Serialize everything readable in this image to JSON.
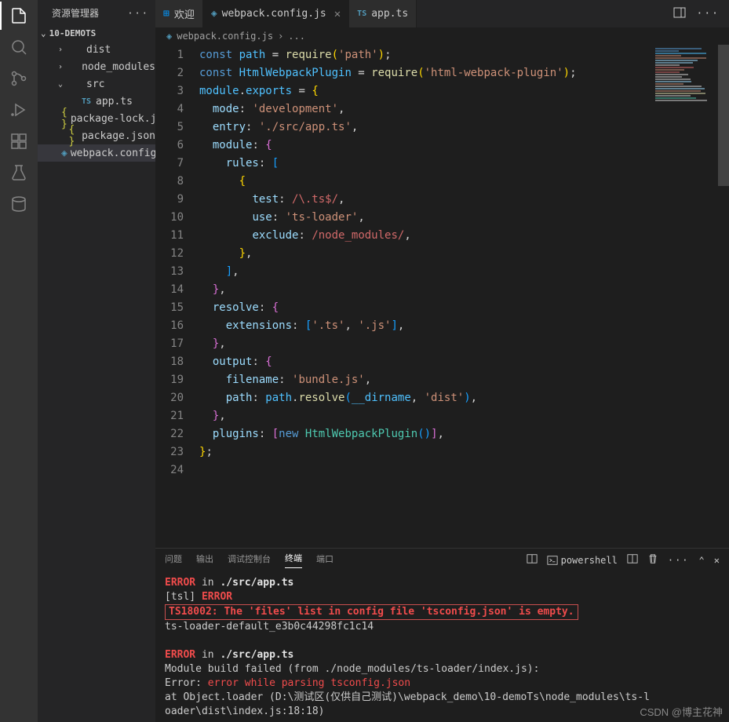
{
  "sidebar": {
    "title": "资源管理器",
    "project": "10-DEMOTS",
    "tree": [
      {
        "type": "folder",
        "label": "dist",
        "expanded": false,
        "depth": 1
      },
      {
        "type": "folder",
        "label": "node_modules",
        "expanded": false,
        "depth": 1
      },
      {
        "type": "folder",
        "label": "src",
        "expanded": true,
        "depth": 1
      },
      {
        "type": "file",
        "label": "app.ts",
        "icon": "ts",
        "depth": 2
      },
      {
        "type": "file",
        "label": "package-lock.json",
        "icon": "json",
        "depth": 1
      },
      {
        "type": "file",
        "label": "package.json",
        "icon": "json",
        "depth": 1
      },
      {
        "type": "file",
        "label": "webpack.config.js",
        "icon": "wp",
        "depth": 1,
        "selected": true
      }
    ]
  },
  "tabs": [
    {
      "label": "欢迎",
      "icon": "vs"
    },
    {
      "label": "webpack.config.js",
      "icon": "wp",
      "active": true,
      "modified": false,
      "closable": true
    },
    {
      "label": "app.ts",
      "icon": "ts"
    }
  ],
  "breadcrumb": {
    "file": "webpack.config.js"
  },
  "code": {
    "lines": 24,
    "tokens": [
      [
        [
          "kw",
          "const "
        ],
        [
          "var",
          "path"
        ],
        [
          "op",
          " = "
        ],
        [
          "fn",
          "require"
        ],
        [
          "br-y",
          "("
        ],
        [
          "str",
          "'path'"
        ],
        [
          "br-y",
          ")"
        ],
        [
          "pun",
          ";"
        ]
      ],
      [
        [
          "kw",
          "const "
        ],
        [
          "var",
          "HtmlWebpackPlugin"
        ],
        [
          "op",
          " = "
        ],
        [
          "fn",
          "require"
        ],
        [
          "br-y",
          "("
        ],
        [
          "str",
          "'html-webpack-plugin'"
        ],
        [
          "br-y",
          ")"
        ],
        [
          "pun",
          ";"
        ]
      ],
      [
        [
          "var",
          "module"
        ],
        [
          "pun",
          "."
        ],
        [
          "var",
          "exports"
        ],
        [
          "op",
          " = "
        ],
        [
          "br-y",
          "{"
        ]
      ],
      [
        [
          "pun",
          "  "
        ],
        [
          "prop",
          "mode"
        ],
        [
          "pun",
          ": "
        ],
        [
          "str",
          "'development'"
        ],
        [
          "pun",
          ","
        ]
      ],
      [
        [
          "pun",
          "  "
        ],
        [
          "prop",
          "entry"
        ],
        [
          "pun",
          ": "
        ],
        [
          "str",
          "'./src/app.ts'"
        ],
        [
          "pun",
          ","
        ]
      ],
      [
        [
          "pun",
          "  "
        ],
        [
          "prop",
          "module"
        ],
        [
          "pun",
          ": "
        ],
        [
          "br-p",
          "{"
        ]
      ],
      [
        [
          "pun",
          "    "
        ],
        [
          "prop",
          "rules"
        ],
        [
          "pun",
          ": "
        ],
        [
          "br-b",
          "["
        ]
      ],
      [
        [
          "pun",
          "      "
        ],
        [
          "br-y",
          "{"
        ]
      ],
      [
        [
          "pun",
          "        "
        ],
        [
          "prop",
          "test"
        ],
        [
          "pun",
          ": "
        ],
        [
          "re",
          "/\\.ts$/"
        ],
        [
          "pun",
          ","
        ]
      ],
      [
        [
          "pun",
          "        "
        ],
        [
          "prop",
          "use"
        ],
        [
          "pun",
          ": "
        ],
        [
          "str",
          "'ts-loader'"
        ],
        [
          "pun",
          ","
        ]
      ],
      [
        [
          "pun",
          "        "
        ],
        [
          "prop",
          "exclude"
        ],
        [
          "pun",
          ": "
        ],
        [
          "re",
          "/node_modules/"
        ],
        [
          "pun",
          ","
        ]
      ],
      [
        [
          "pun",
          "      "
        ],
        [
          "br-y",
          "}"
        ],
        [
          "pun",
          ","
        ]
      ],
      [
        [
          "pun",
          "    "
        ],
        [
          "br-b",
          "]"
        ],
        [
          "pun",
          ","
        ]
      ],
      [
        [
          "pun",
          "  "
        ],
        [
          "br-p",
          "}"
        ],
        [
          "pun",
          ","
        ]
      ],
      [
        [
          "pun",
          "  "
        ],
        [
          "prop",
          "resolve"
        ],
        [
          "pun",
          ": "
        ],
        [
          "br-p",
          "{"
        ]
      ],
      [
        [
          "pun",
          "    "
        ],
        [
          "prop",
          "extensions"
        ],
        [
          "pun",
          ": "
        ],
        [
          "br-b",
          "["
        ],
        [
          "str",
          "'.ts'"
        ],
        [
          "pun",
          ", "
        ],
        [
          "str",
          "'.js'"
        ],
        [
          "br-b",
          "]"
        ],
        [
          "pun",
          ","
        ]
      ],
      [
        [
          "pun",
          "  "
        ],
        [
          "br-p",
          "}"
        ],
        [
          "pun",
          ","
        ]
      ],
      [
        [
          "pun",
          "  "
        ],
        [
          "prop",
          "output"
        ],
        [
          "pun",
          ": "
        ],
        [
          "br-p",
          "{"
        ]
      ],
      [
        [
          "pun",
          "    "
        ],
        [
          "prop",
          "filename"
        ],
        [
          "pun",
          ": "
        ],
        [
          "str",
          "'bundle.js'"
        ],
        [
          "pun",
          ","
        ]
      ],
      [
        [
          "pun",
          "    "
        ],
        [
          "prop",
          "path"
        ],
        [
          "pun",
          ": "
        ],
        [
          "var",
          "path"
        ],
        [
          "pun",
          "."
        ],
        [
          "fn",
          "resolve"
        ],
        [
          "br-b",
          "("
        ],
        [
          "var",
          "__dirname"
        ],
        [
          "pun",
          ", "
        ],
        [
          "str",
          "'dist'"
        ],
        [
          "br-b",
          ")"
        ],
        [
          "pun",
          ","
        ]
      ],
      [
        [
          "pun",
          "  "
        ],
        [
          "br-p",
          "}"
        ],
        [
          "pun",
          ","
        ]
      ],
      [
        [
          "pun",
          "  "
        ],
        [
          "prop",
          "plugins"
        ],
        [
          "pun",
          ": "
        ],
        [
          "br-p",
          "["
        ],
        [
          "kw",
          "new "
        ],
        [
          "cls",
          "HtmlWebpackPlugin"
        ],
        [
          "br-b",
          "("
        ],
        [
          "br-b",
          ")"
        ],
        [
          "br-p",
          "]"
        ],
        [
          "pun",
          ","
        ]
      ],
      [
        [
          "br-y",
          "}"
        ],
        [
          "pun",
          ";"
        ]
      ],
      []
    ]
  },
  "terminal": {
    "tabs": [
      "问题",
      "输出",
      "调试控制台",
      "终端",
      "端口"
    ],
    "active_tab": "终端",
    "shell_label": "powershell",
    "content": [
      {
        "segments": [
          [
            "err",
            "ERROR"
          ],
          [
            "plain",
            " in "
          ],
          [
            "bold",
            "./src/app.ts"
          ]
        ]
      },
      {
        "segments": [
          [
            "plain",
            "[tsl] "
          ],
          [
            "err",
            "ERROR"
          ]
        ]
      },
      {
        "box": true,
        "segments": [
          [
            "plain",
            "      "
          ],
          [
            "err",
            "TS18002: The 'files' list in config file 'tsconfig.json' is empty."
          ]
        ]
      },
      {
        "segments": [
          [
            "plain",
            "ts-loader-default_e3b0c44298fc1c14"
          ]
        ]
      },
      {
        "segments": [
          [
            "plain",
            ""
          ]
        ]
      },
      {
        "segments": [
          [
            "err",
            "ERROR"
          ],
          [
            "plain",
            " in "
          ],
          [
            "bold",
            "./src/app.ts"
          ]
        ]
      },
      {
        "segments": [
          [
            "plain",
            "Module build failed (from ./node_modules/ts-loader/index.js):"
          ]
        ]
      },
      {
        "segments": [
          [
            "plain",
            "Error: "
          ],
          [
            "err2",
            "error while parsing tsconfig.json"
          ]
        ]
      },
      {
        "segments": [
          [
            "plain",
            "    at Object.loader (D:\\测试区(仅供自己测试)\\webpack_demo\\10-demoTs\\node_modules\\ts-l"
          ]
        ]
      },
      {
        "segments": [
          [
            "plain",
            "oader\\dist\\index.js:18:18)"
          ]
        ]
      }
    ]
  },
  "watermark": "CSDN @博主花神"
}
